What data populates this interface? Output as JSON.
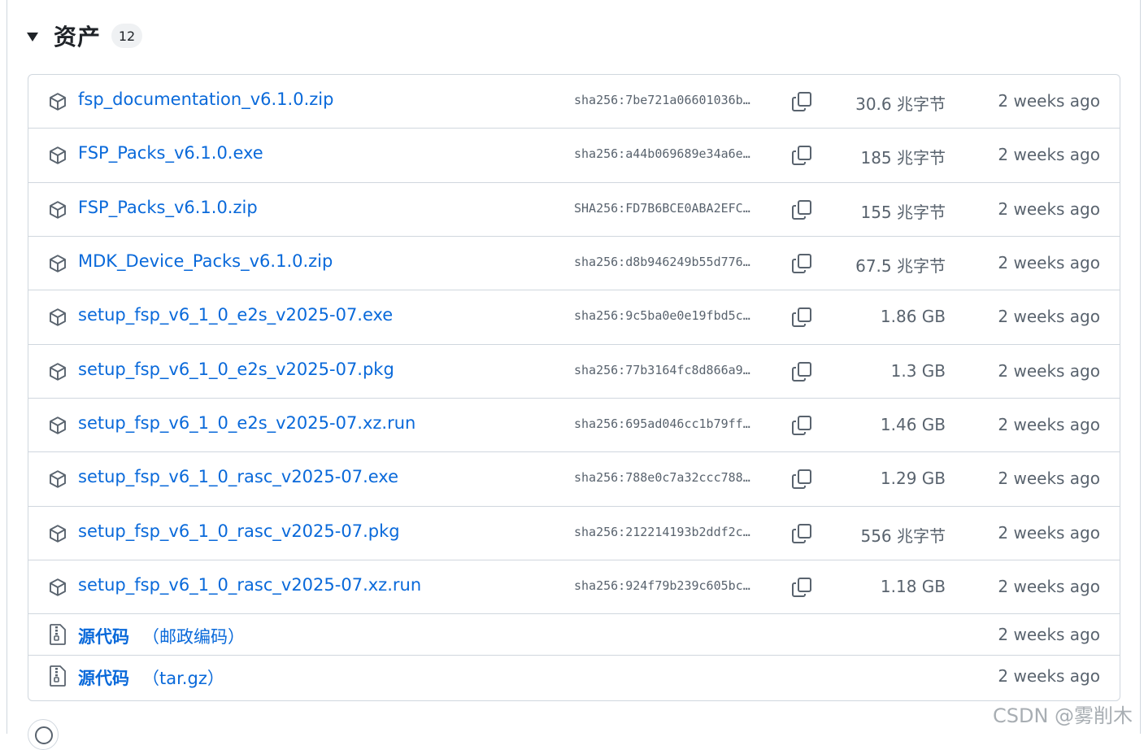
{
  "header": {
    "title": "资产",
    "count": "12"
  },
  "assets": [
    {
      "name": "fsp_documentation_v6.1.0.zip",
      "sha": "sha256:7be721a06601036b…",
      "size": "30.6 兆字节",
      "ago": "2 weeks ago"
    },
    {
      "name": "FSP_Packs_v6.1.0.exe",
      "sha": "sha256:a44b069689e34a6e…",
      "size": "185 兆字节",
      "ago": "2 weeks ago"
    },
    {
      "name": "FSP_Packs_v6.1.0.zip",
      "sha": "SHA256:FD7B6BCE0ABA2EFC…",
      "size": "155 兆字节",
      "ago": "2 weeks ago"
    },
    {
      "name": "MDK_Device_Packs_v6.1.0.zip",
      "sha": "sha256:d8b946249b55d776…",
      "size": "67.5 兆字节",
      "ago": "2 weeks ago"
    },
    {
      "name": "setup_fsp_v6_1_0_e2s_v2025-07.exe",
      "sha": "sha256:9c5ba0e0e19fbd5c…",
      "size": "1.86 GB",
      "ago": "2 weeks ago"
    },
    {
      "name": "setup_fsp_v6_1_0_e2s_v2025-07.pkg",
      "sha": "sha256:77b3164fc8d866a9…",
      "size": "1.3 GB",
      "ago": "2 weeks ago"
    },
    {
      "name": "setup_fsp_v6_1_0_e2s_v2025-07.xz.run",
      "sha": "sha256:695ad046cc1b79ff…",
      "size": "1.46 GB",
      "ago": "2 weeks ago"
    },
    {
      "name": "setup_fsp_v6_1_0_rasc_v2025-07.exe",
      "sha": "sha256:788e0c7a32ccc788…",
      "size": "1.29 GB",
      "ago": "2 weeks ago"
    },
    {
      "name": "setup_fsp_v6_1_0_rasc_v2025-07.pkg",
      "sha": "sha256:212214193b2ddf2c…",
      "size": "556 兆字节",
      "ago": "2 weeks ago"
    },
    {
      "name": "setup_fsp_v6_1_0_rasc_v2025-07.xz.run",
      "sha": "sha256:924f79b239c605bc…",
      "size": "1.18 GB",
      "ago": "2 weeks ago"
    }
  ],
  "source": [
    {
      "label": "源代码",
      "format": "（邮政编码）",
      "ago": "2 weeks ago"
    },
    {
      "label": "源代码",
      "format": "（tar.gz）",
      "ago": "2 weeks ago"
    }
  ],
  "watermark": "CSDN @雾削木",
  "icons": {
    "asset": "package-icon",
    "copy": "copy-icon",
    "source": "file-zip-icon",
    "collapse": "triangle-down-icon",
    "reaction": "smiley-icon"
  },
  "colors": {
    "link": "#0969da",
    "muted": "#59636e",
    "border": "#d0d7de"
  }
}
